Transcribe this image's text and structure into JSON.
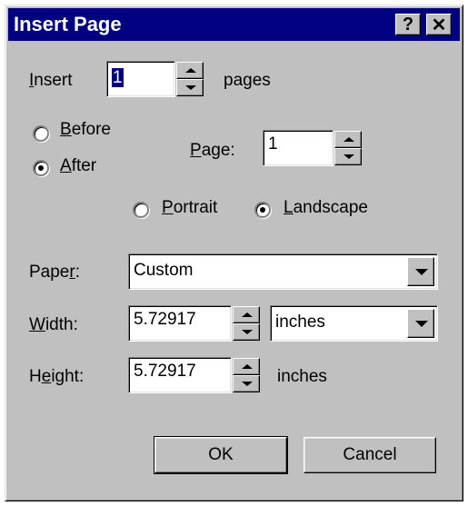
{
  "window": {
    "title": "Insert Page",
    "help_btn": "?",
    "close_btn": "✕"
  },
  "insert": {
    "label_u": "I",
    "label_rest": "nsert",
    "value": "1",
    "suffix": "pages"
  },
  "position": {
    "before_u": "B",
    "before_rest": "efore",
    "after_u": "A",
    "after_rest": "fter",
    "selected": "after"
  },
  "page": {
    "label_u": "P",
    "label_rest": "age:",
    "value": "1"
  },
  "orientation": {
    "portrait_u": "P",
    "portrait_rest": "ortrait",
    "landscape_u": "L",
    "landscape_rest": "andscape",
    "selected": "landscape"
  },
  "paper": {
    "label_pre": "Pape",
    "label_u": "r",
    "label_post": ":",
    "value": "Custom"
  },
  "width": {
    "label_u": "W",
    "label_rest": "idth:",
    "value": "5.72917",
    "unit": "inches"
  },
  "height": {
    "label_pre": "H",
    "label_u": "e",
    "label_rest": "ight:",
    "value": "5.72917",
    "unit": "inches"
  },
  "buttons": {
    "ok": "OK",
    "cancel": "Cancel"
  }
}
